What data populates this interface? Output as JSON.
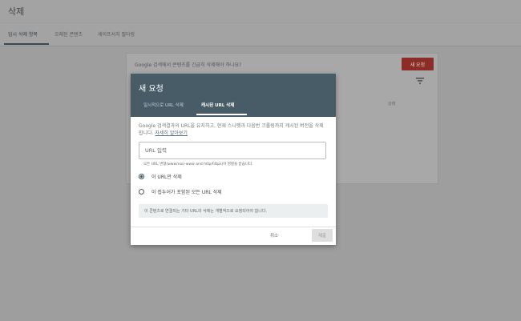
{
  "page": {
    "title": "삭제",
    "tabs": [
      {
        "label": "임시 삭제 항목"
      },
      {
        "label": "오래된 콘텐츠"
      },
      {
        "label": "세이프서치 필터링"
      }
    ]
  },
  "card": {
    "question": "Google 검색에서 콘텐츠를 긴급히 삭제해야 하나요?",
    "new_request_label": "새 요청",
    "status_col": "상태"
  },
  "dialog": {
    "title": "새 요청",
    "tabs": [
      {
        "label": "일시적으로 URL 삭제"
      },
      {
        "label": "캐시된 URL 삭제"
      }
    ],
    "description": "Google 검색결과의 URL을 유지하고, 현재 스니펫과 다음번 크롤링까지 캐시된 버전을 삭제합니다.",
    "learn_more": "자세히 알아보기",
    "url_placeholder": "URL 입력",
    "url_value": "",
    "input_hint": "모든 URL 변형(www/non-www and http/https)이 영향을 받습니다.",
    "options": [
      {
        "label": "이 URL만 삭제",
        "checked": true
      },
      {
        "label": "이 접두어가 포함된 모든 URL 삭제",
        "checked": false
      }
    ],
    "info": "이 콘텐츠로 연결되는 기타 URL의 삭제는 개별적으로 요청되어야 합니다.",
    "cancel_label": "취소",
    "submit_label": "제출"
  },
  "colors": {
    "dialog_header": "#485c67",
    "overlay_bg": "#9e9e9e",
    "new_request_btn": "#8b2d26"
  }
}
